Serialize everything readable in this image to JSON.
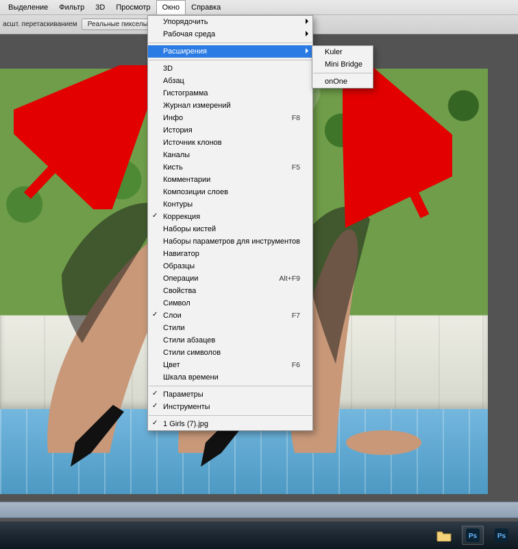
{
  "menubar": {
    "items": [
      "Выделение",
      "Фильтр",
      "3D",
      "Просмотр",
      "Окно",
      "Справка"
    ],
    "active_index": 4
  },
  "optionsbar": {
    "drag_label": "асшт. перетаскиванием",
    "real_pixels_btn": "Реальные пикселы"
  },
  "window_menu": {
    "section1": [
      {
        "label": "Упорядочить",
        "submenu": true
      },
      {
        "label": "Рабочая среда",
        "submenu": true
      }
    ],
    "extensions": {
      "label": "Расширения",
      "submenu": true,
      "highlight": true
    },
    "section2": [
      {
        "label": "3D"
      },
      {
        "label": "Абзац"
      },
      {
        "label": "Гистограмма"
      },
      {
        "label": "Журнал измерений"
      },
      {
        "label": "Инфо",
        "shortcut": "F8"
      },
      {
        "label": "История"
      },
      {
        "label": "Источник клонов"
      },
      {
        "label": "Каналы"
      },
      {
        "label": "Кисть",
        "shortcut": "F5"
      },
      {
        "label": "Комментарии"
      },
      {
        "label": "Композиции слоев"
      },
      {
        "label": "Контуры"
      },
      {
        "label": "Коррекция",
        "checked": true
      },
      {
        "label": "Наборы кистей"
      },
      {
        "label": "Наборы параметров для инструментов"
      },
      {
        "label": "Навигатор"
      },
      {
        "label": "Образцы"
      },
      {
        "label": "Операции",
        "shortcut": "Alt+F9"
      },
      {
        "label": "Свойства"
      },
      {
        "label": "Символ"
      },
      {
        "label": "Слои",
        "shortcut": "F7",
        "checked": true
      },
      {
        "label": "Стили"
      },
      {
        "label": "Стили абзацев"
      },
      {
        "label": "Стили символов"
      },
      {
        "label": "Цвет",
        "shortcut": "F6"
      },
      {
        "label": "Шкала времени"
      }
    ],
    "section3": [
      {
        "label": "Параметры",
        "checked": true
      },
      {
        "label": "Инструменты",
        "checked": true
      }
    ],
    "section4": [
      {
        "label": "1 Girls (7).jpg",
        "checked": true
      }
    ]
  },
  "extensions_submenu": {
    "group1": [
      {
        "label": "Kuler"
      },
      {
        "label": "Mini Bridge"
      }
    ],
    "group2": [
      {
        "label": "onOne"
      }
    ]
  },
  "taskbar": {
    "icons": [
      "folder-icon",
      "app-ps-icon",
      "app-ps-icon"
    ]
  }
}
